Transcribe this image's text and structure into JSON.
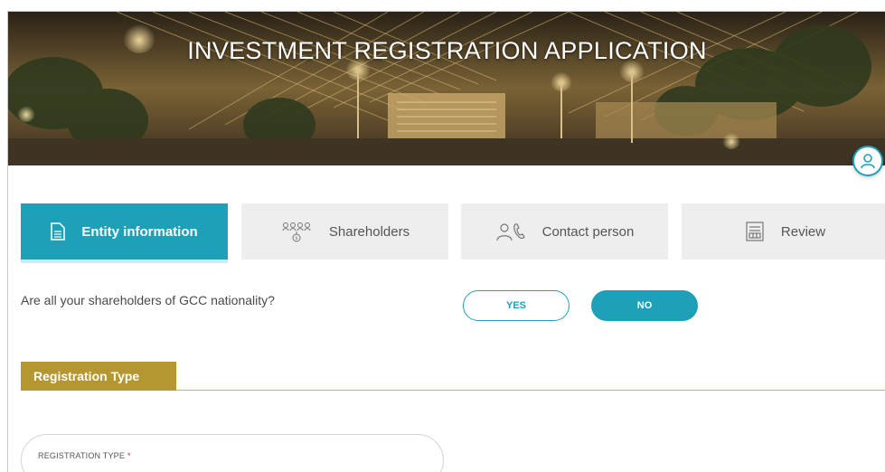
{
  "hero": {
    "title": "INVESTMENT REGISTRATION APPLICATION"
  },
  "user": {
    "icon": "user-icon"
  },
  "tabs": [
    {
      "label": "Entity information",
      "icon": "document-icon",
      "active": true
    },
    {
      "label": "Shareholders",
      "icon": "shareholders-icon",
      "active": false
    },
    {
      "label": "Contact person",
      "icon": "contact-person-icon",
      "active": false
    },
    {
      "label": "Review",
      "icon": "review-icon",
      "active": false
    }
  ],
  "question": {
    "text": "Are all your shareholders of GCC nationality?",
    "yes_label": "YES",
    "no_label": "NO",
    "selected": "NO"
  },
  "section": {
    "title": "Registration Type",
    "field_label": "REGISTRATION TYPE",
    "required_mark": "*"
  },
  "colors": {
    "accent": "#1ea0b8",
    "section": "#b69630",
    "required": "#d0252b"
  }
}
